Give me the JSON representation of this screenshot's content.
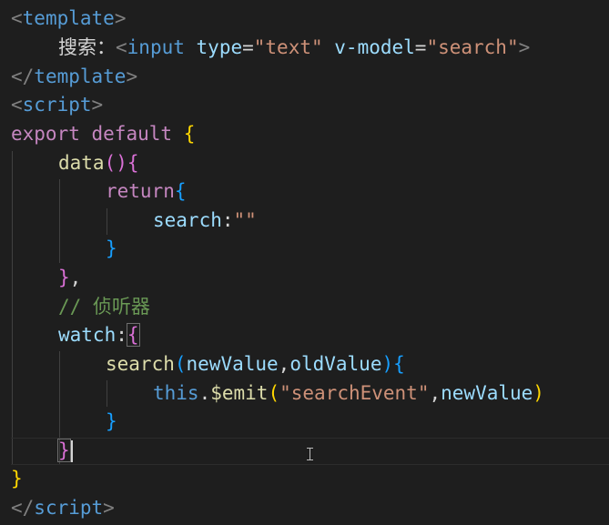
{
  "code": {
    "l1": {
      "lt": "<",
      "tag": "template",
      "gt": ">"
    },
    "l2": {
      "label": "搜索：",
      "lt": "<",
      "tag": "input",
      "attr1": "type",
      "eq1": "=",
      "val1": "\"text\"",
      "attr2": "v-model",
      "eq2": "=",
      "val2": "\"search\"",
      "gt": ">"
    },
    "l3": {
      "lt": "</",
      "tag": "template",
      "gt": ">"
    },
    "l4": {
      "lt": "<",
      "tag": "script",
      "gt": ">"
    },
    "l5": {
      "kw": "export",
      "kw2": "default",
      "brace": "{"
    },
    "l6": {
      "fn": "data",
      "parens": "()",
      "brace": "{"
    },
    "l7": {
      "kw": "return",
      "brace": "{"
    },
    "l8": {
      "prop": "search",
      "colon": ":",
      "str": "\"\""
    },
    "l9": {
      "brace": "}"
    },
    "l10": {
      "brace": "}",
      "comma": ","
    },
    "l11": {
      "comment": "// 侦听器"
    },
    "l12": {
      "prop": "watch",
      "colon": ":",
      "brace": "{"
    },
    "l13": {
      "fn": "search",
      "lp": "(",
      "p1": "newValue",
      "comma": ",",
      "p2": "oldValue",
      "rp": ")",
      "brace": "{"
    },
    "l14": {
      "kw": "this",
      "dot": ".",
      "fn": "$emit",
      "lp": "(",
      "str": "\"searchEvent\"",
      "comma": ",",
      "arg": "newValue",
      "rp": ")"
    },
    "l15": {
      "brace": "}"
    },
    "l16": {
      "brace": "}"
    },
    "l17": {
      "brace": "}"
    },
    "l18": {
      "lt": "</",
      "tag": "script",
      "gt": ">"
    }
  },
  "colors": {
    "background": "#1e1e1e",
    "tag_bracket": "#808080",
    "tag_name": "#569cd6",
    "attribute": "#9cdcfe",
    "string": "#ce9178",
    "keyword_control": "#c586c0",
    "function": "#dcdcaa",
    "comment": "#6a9955",
    "brace_level1": "#ffd700",
    "brace_level2": "#da70d6",
    "brace_level3": "#179fff"
  },
  "icons": {
    "mouse_cursor": "i-beam-cursor-icon"
  }
}
